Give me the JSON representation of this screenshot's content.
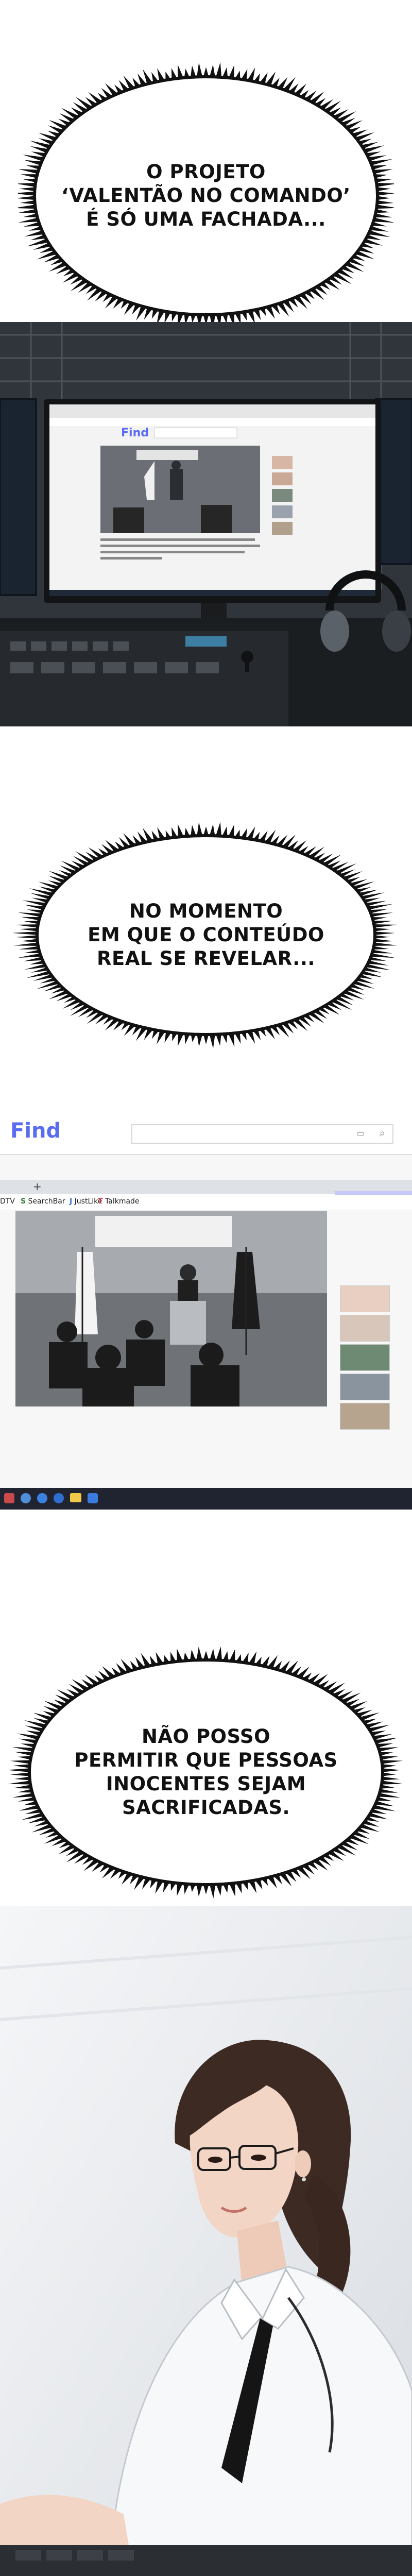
{
  "bubbles": {
    "b1": {
      "line1": "O PROJETO",
      "line2": "‘VALENTÃO NO COMANDO’",
      "line3": "É SÓ UMA FACHADA..."
    },
    "b2": {
      "line1": "NO MOMENTO",
      "line2": "EM QUE O CONTEÚDO",
      "line3": "REAL SE REVELAR..."
    },
    "b3": {
      "line1": "NÃO POSSO",
      "line2": "PERMITIR QUE PESSOAS",
      "line3": "INOCENTES SEJAM",
      "line4": "SACRIFICADAS."
    }
  },
  "browser": {
    "logo": "Find",
    "bookmarks": [
      "SearchBar",
      "JustLike",
      "Talkmade"
    ],
    "tv_prefix": "DTV"
  },
  "colors": {
    "bubble_fill": "#ffffff",
    "bubble_edge": "#111111",
    "logo_blue": "#5a6cf0",
    "flag_dark": "#1c1c1c"
  }
}
